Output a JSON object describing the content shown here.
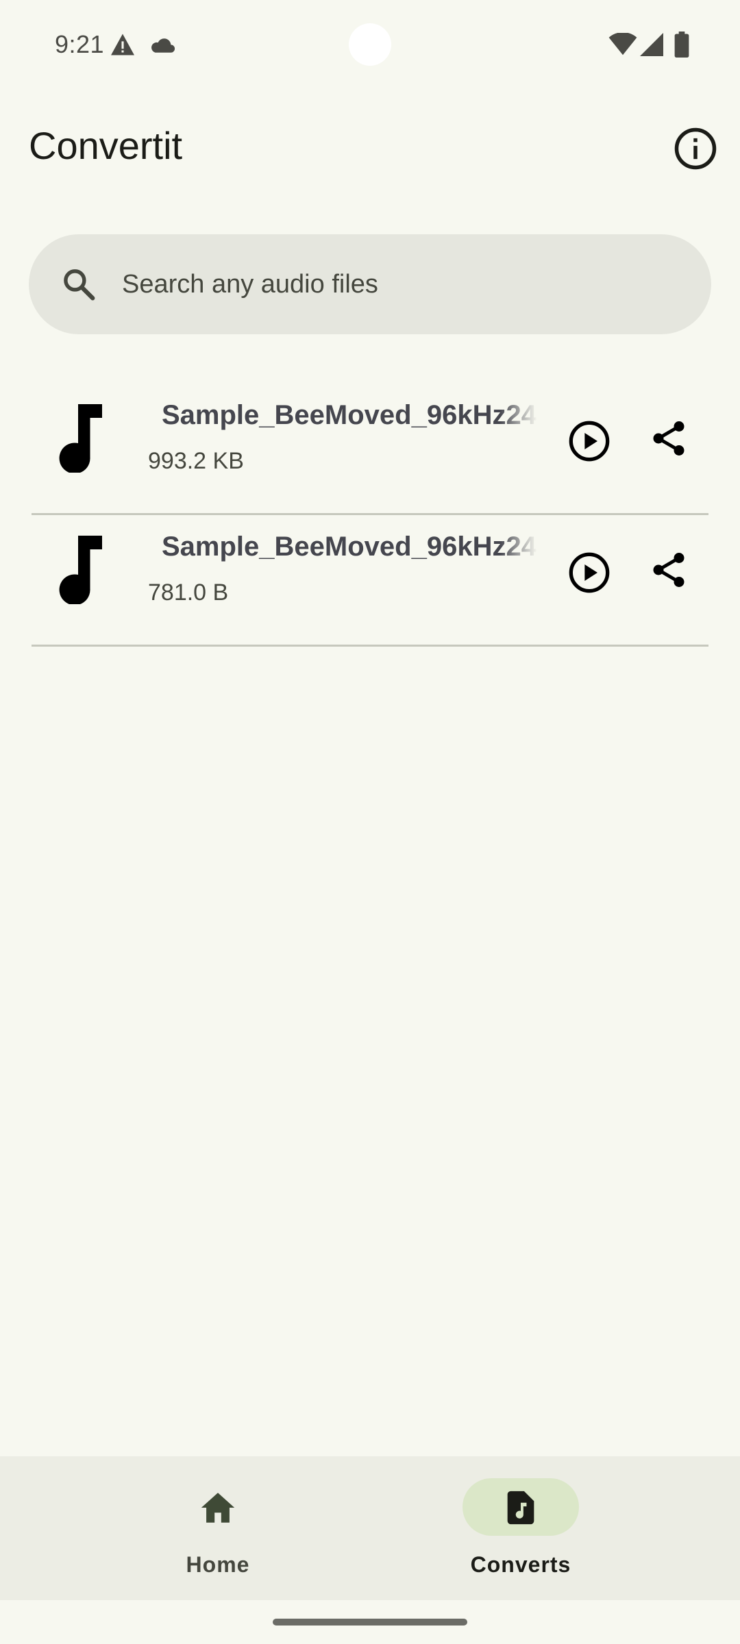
{
  "status_bar": {
    "time": "9:21",
    "left_icons": [
      "warning-icon",
      "cloud-icon"
    ],
    "right_icons": [
      "wifi-icon",
      "cellular-signal-icon",
      "battery-icon"
    ]
  },
  "app_bar": {
    "title": "Convertit",
    "action_icon": "info-icon"
  },
  "search": {
    "placeholder": "Search any audio files",
    "value": "",
    "icon": "search-icon"
  },
  "files": [
    {
      "name": "Sample_BeeMoved_96kHz24",
      "size": "993.2 KB",
      "icon": "music-note-icon"
    },
    {
      "name": "Sample_BeeMoved_96kHz24",
      "size": "781.0 B",
      "icon": "music-note-icon"
    }
  ],
  "bottom_nav": {
    "items": [
      {
        "label": "Home",
        "icon": "home-icon",
        "selected": false
      },
      {
        "label": "Converts",
        "icon": "audio-file-icon",
        "selected": true
      }
    ]
  },
  "colors": {
    "background": "#f7f8f0",
    "search_bg": "#e5e6de",
    "nav_bg": "#ecede4",
    "nav_active_pill": "#dbe7c8",
    "divider": "#c6c8bd"
  }
}
